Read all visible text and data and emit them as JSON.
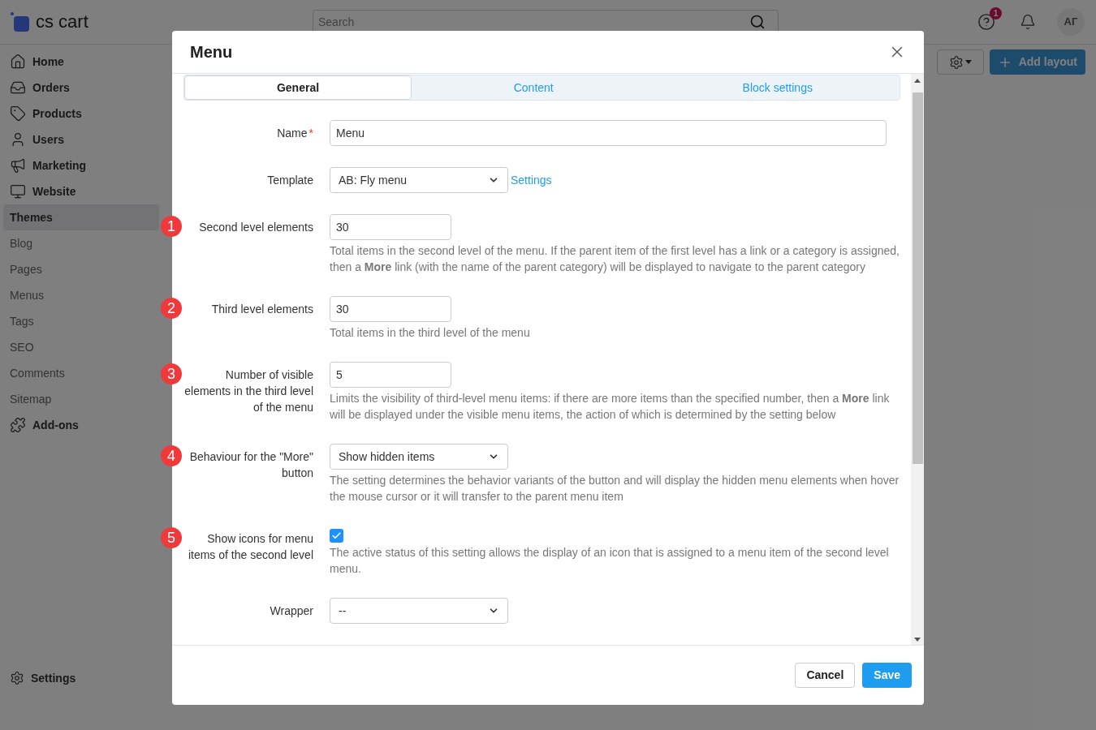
{
  "app": {
    "logo": "cs cart",
    "search": {
      "placeholder": "Search"
    },
    "help_badge": "1",
    "avatar": "АГ",
    "add_button": "Add layout"
  },
  "sidebar": {
    "items": [
      {
        "label": "Home",
        "kind": "main",
        "selected": false
      },
      {
        "label": "Orders",
        "kind": "main",
        "selected": false
      },
      {
        "label": "Products",
        "kind": "main",
        "selected": false
      },
      {
        "label": "Users",
        "kind": "main",
        "selected": false
      },
      {
        "label": "Marketing",
        "kind": "main",
        "selected": false
      },
      {
        "label": "Website",
        "kind": "main",
        "selected": false
      },
      {
        "label": "Themes",
        "kind": "sub",
        "selected": true
      },
      {
        "label": "Blog",
        "kind": "sub",
        "selected": false
      },
      {
        "label": "Pages",
        "kind": "sub",
        "selected": false
      },
      {
        "label": "Menus",
        "kind": "sub",
        "selected": false
      },
      {
        "label": "Tags",
        "kind": "sub",
        "selected": false
      },
      {
        "label": "SEO",
        "kind": "sub",
        "selected": false
      },
      {
        "label": "Comments",
        "kind": "sub",
        "selected": false
      },
      {
        "label": "Sitemap",
        "kind": "sub",
        "selected": false
      },
      {
        "label": "Add-ons",
        "kind": "main",
        "selected": false
      }
    ],
    "footer": "Settings"
  },
  "modal": {
    "title": "Menu",
    "tabs": [
      {
        "label": "General",
        "selected": true
      },
      {
        "label": "Content",
        "selected": false
      },
      {
        "label": "Block settings",
        "selected": false
      }
    ],
    "fields": [
      {
        "kind": "text",
        "label": "Name",
        "required_mark": "*",
        "value": "Menu"
      },
      {
        "kind": "select",
        "label": "Template",
        "value": "AB: Fly menu",
        "link": "Settings"
      },
      {
        "kind": "number",
        "step": "1",
        "label": "Second level elements",
        "value": "30",
        "help": "Total items in the second level of the menu. If the parent item of the first level has a link or a category is assigned, then a **More** link (with the name of the parent category) will be displayed to navigate to the parent category"
      },
      {
        "kind": "number",
        "step": "2",
        "label": "Third level elements",
        "value": "30",
        "help": "Total items in the third level of the menu"
      },
      {
        "kind": "number",
        "step": "3",
        "label": "Number of visible elements in the third level of the menu",
        "value": "5",
        "help": "Limits the visibility of third-level menu items: if there are more items than the specified number, then a **More** link will be displayed under the visible menu items, the action of which is determined by the setting below"
      },
      {
        "kind": "select",
        "step": "4",
        "label": "Behaviour for the \"More\" button",
        "value": "Show hidden items",
        "help": "The setting determines the behavior variants of the button and will display the hidden menu elements when hover the mouse cursor or it will transfer to the parent menu item"
      },
      {
        "kind": "checkbox",
        "step": "5",
        "label": "Show icons for menu items of the second level",
        "checked": true,
        "help": "The active status of this setting allows the display of an icon that is assigned to a menu item of the second level menu."
      },
      {
        "kind": "select",
        "label": "Wrapper",
        "value": "--"
      }
    ],
    "buttons": {
      "cancel": "Cancel",
      "save": "Save"
    }
  }
}
